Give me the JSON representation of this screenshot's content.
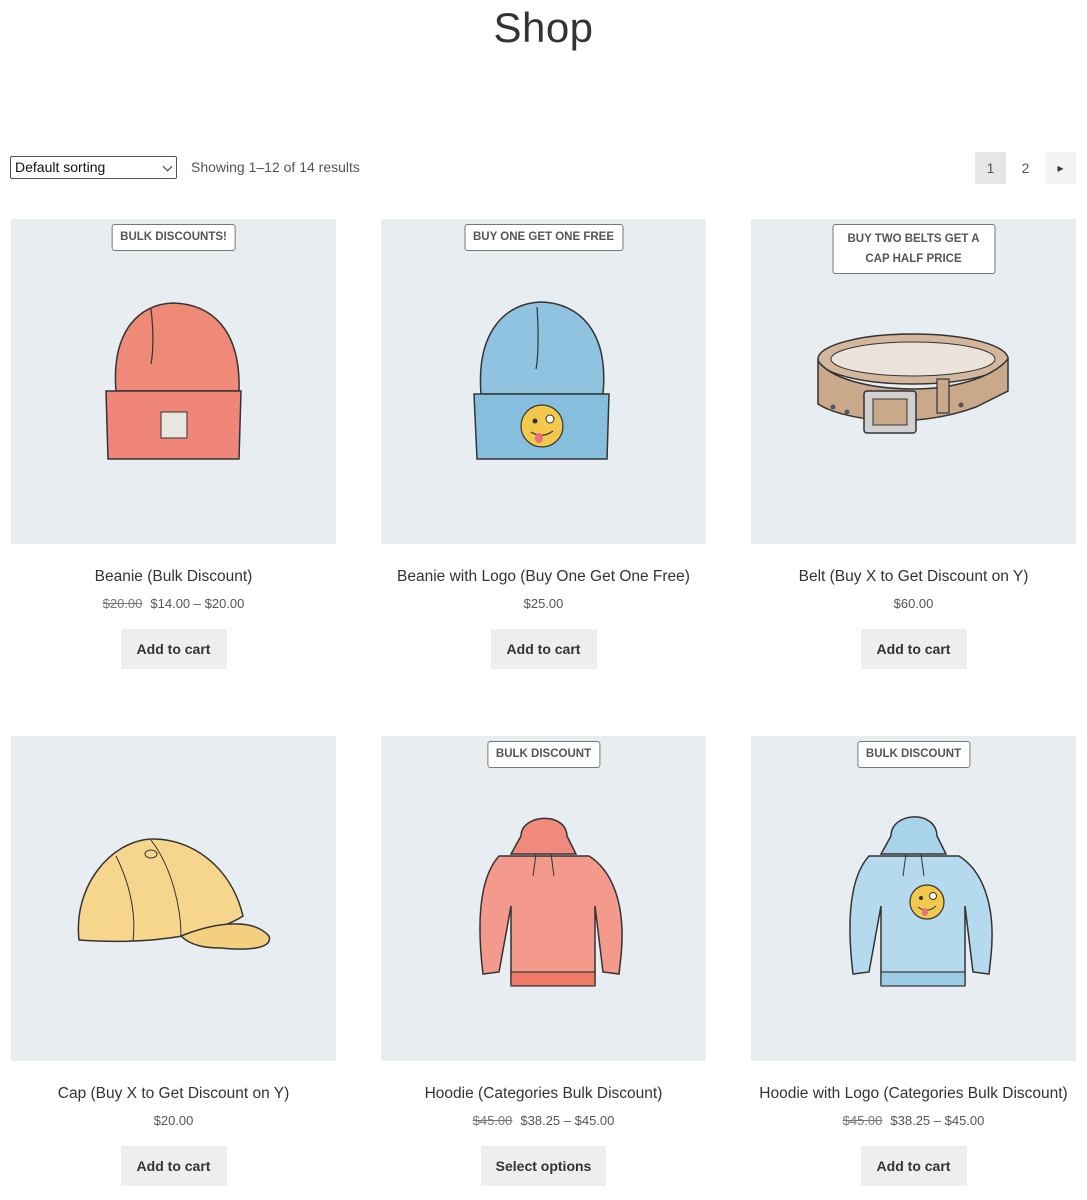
{
  "page": {
    "title": "Shop"
  },
  "toolbar": {
    "sort_value": "Default sorting",
    "result_count": "Showing 1–12 of 14 results",
    "pages": [
      "1",
      "2"
    ],
    "next_glyph": "▸"
  },
  "products": [
    {
      "badge": "Bulk Discounts!",
      "name": "Beanie (Bulk Discount)",
      "old_price": "$20.00",
      "price": "$14.00 – $20.00",
      "button": "Add to cart",
      "image": "beanie-orange"
    },
    {
      "badge": "Buy One Get One Free",
      "name": "Beanie with Logo (Buy One Get One Free)",
      "old_price": "",
      "price": "$25.00",
      "button": "Add to cart",
      "image": "beanie-blue-logo"
    },
    {
      "badge": "Buy Two Belts Get A Cap Half Price",
      "name": "Belt (Buy X to Get Discount on Y)",
      "old_price": "",
      "price": "$60.00",
      "button": "Add to cart",
      "image": "belt"
    },
    {
      "badge": "",
      "name": "Cap (Buy X to Get Discount on Y)",
      "old_price": "",
      "price": "$20.00",
      "button": "Add to cart",
      "image": "cap-yellow"
    },
    {
      "badge": "Bulk Discount",
      "name": "Hoodie (Categories Bulk Discount)",
      "old_price": "$45.00",
      "price": "$38.25 – $45.00",
      "button": "Select options",
      "image": "hoodie-red"
    },
    {
      "badge": "Bulk Discount",
      "name": "Hoodie with Logo (Categories Bulk Discount)",
      "old_price": "$45.00",
      "price": "$38.25 – $45.00",
      "button": "Add to cart",
      "image": "hoodie-blue-logo"
    }
  ],
  "colors": {
    "thumb_bg": "#e8edf2",
    "button_bg": "#eeeeee",
    "text": "#333333"
  }
}
